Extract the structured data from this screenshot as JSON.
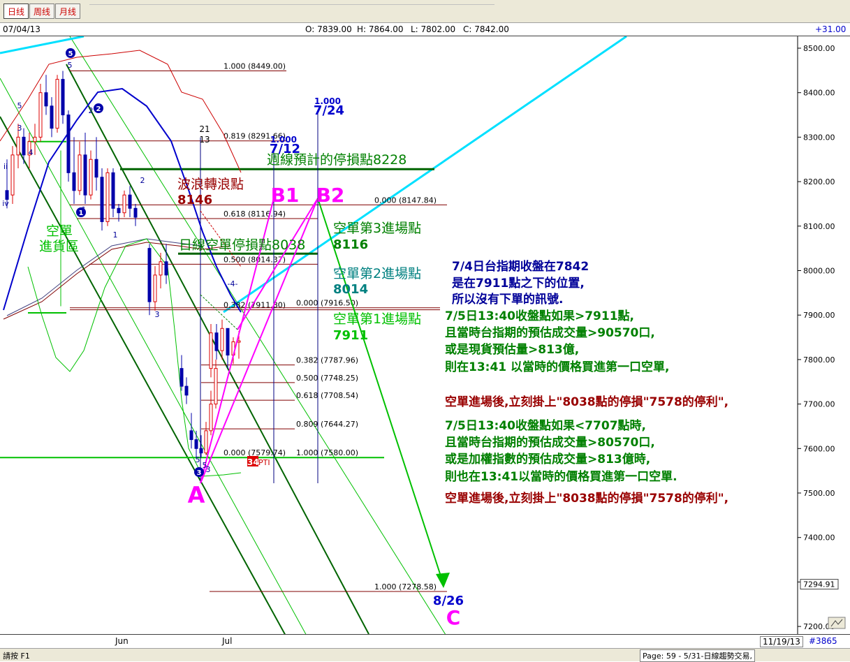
{
  "toolbar": {
    "tabs": [
      {
        "label": "日线",
        "active": true
      },
      {
        "label": "周线",
        "active": false
      },
      {
        "label": "月线",
        "active": false
      }
    ]
  },
  "infobar": {
    "date": "07/04/13",
    "open": "O: 7839.00",
    "high": "H: 7864.00",
    "low": "L: 7802.00",
    "close": "C: 7842.00",
    "change": "+31.00"
  },
  "bottombar": {
    "x_labels": [
      "Jun",
      "Jul"
    ],
    "date": "11/19/13",
    "code": "#3865"
  },
  "statusbar": {
    "left": "請按 F1",
    "right": "Page: 59 - 5/31-日線趨勢交易,"
  },
  "chart_data": {
    "type": "candlestick",
    "ylim": [
      7185,
      8530
    ],
    "y_ticks": [
      "8500.00",
      "8400.00",
      "8300.00",
      "8200.00",
      "8100.00",
      "8000.00",
      "7900.00",
      "7800.00",
      "7700.00",
      "7600.00",
      "7500.00",
      "7400.00",
      "7300.00",
      "7200.00"
    ],
    "last_price_label": "7294.91",
    "colors": {
      "up": "#dd0000",
      "down": "#0000aa",
      "fib": "#800000",
      "green_text": "#008000",
      "note_blue": "#000099",
      "note_green": "#008000",
      "note_red": "#990000",
      "magenta": "#ff00ff",
      "cyan": "#00e0ff"
    },
    "candles": [
      [
        8180,
        8250,
        8140,
        8160
      ],
      [
        8170,
        8280,
        8150,
        8260
      ],
      [
        8260,
        8330,
        8230,
        8300
      ],
      [
        8300,
        8320,
        8240,
        8260
      ],
      [
        8260,
        8310,
        8230,
        8290
      ],
      [
        8290,
        8330,
        8260,
        8300
      ],
      [
        8300,
        8420,
        8290,
        8400
      ],
      [
        8400,
        8440,
        8350,
        8370
      ],
      [
        8370,
        8390,
        8300,
        8320
      ],
      [
        8320,
        8440,
        8310,
        8430
      ],
      [
        8430,
        8449,
        8330,
        8350
      ],
      [
        8350,
        8360,
        8200,
        8220
      ],
      [
        8220,
        8300,
        8150,
        8180
      ],
      [
        8180,
        8290,
        8170,
        8260
      ],
      [
        8260,
        8310,
        8150,
        8170
      ],
      [
        8170,
        8270,
        8160,
        8250
      ],
      [
        8250,
        8300,
        8180,
        8210
      ],
      [
        8210,
        8230,
        8090,
        8110
      ],
      [
        8110,
        8230,
        8100,
        8220
      ],
      [
        8220,
        8230,
        8120,
        8140
      ],
      [
        8140,
        8150,
        8110,
        8130
      ],
      [
        8130,
        8180,
        8120,
        8170
      ],
      [
        8170,
        8190,
        8120,
        8140
      ],
      [
        8140,
        8150,
        8100,
        8120
      ],
      [
        8050,
        8060,
        7900,
        7930
      ],
      [
        7930,
        8010,
        7910,
        7990
      ],
      [
        7990,
        8040,
        7960,
        8020
      ],
      [
        8020,
        8060,
        7970,
        7990
      ],
      [
        7780,
        7810,
        7730,
        7740
      ],
      [
        7740,
        7760,
        7700,
        7720
      ],
      [
        7640,
        7680,
        7600,
        7620
      ],
      [
        7620,
        7640,
        7580,
        7600
      ],
      [
        7600,
        7630,
        7580,
        7590
      ],
      [
        7590,
        7660,
        7585,
        7640
      ],
      [
        7640,
        7730,
        7630,
        7700
      ],
      [
        7700,
        7800,
        7690,
        7780
      ],
      [
        7780,
        7880,
        7760,
        7860
      ],
      [
        7860,
        7880,
        7800,
        7820
      ],
      [
        7820,
        7890,
        7800,
        7870
      ],
      [
        7870,
        7870,
        7780,
        7810
      ],
      [
        7810,
        7850,
        7790,
        7840
      ],
      [
        7839,
        7864,
        7802,
        7842
      ]
    ],
    "fib_levels": [
      {
        "label": "1.000 (8449.00)",
        "y": 8449
      },
      {
        "label": "0.819 (8291.66)",
        "y": 8291.66
      },
      {
        "label": "0.000 (8147.84)",
        "y": 8147.84
      },
      {
        "label": "0.618 (8116.94)",
        "y": 8116.94
      },
      {
        "label": "0.500 (8014.37)",
        "y": 8014.37
      },
      {
        "label": "0.382 (7911.80)",
        "y": 7911.8
      },
      {
        "label": "0.000 (7916.50)",
        "y": 7916.5
      },
      {
        "label": "0.382 (7787.96)",
        "y": 7787.96
      },
      {
        "label": "0.500 (7748.25)",
        "y": 7748.25
      },
      {
        "label": "0.618 (7708.54)",
        "y": 7708.54
      },
      {
        "label": "0.809 (7644.27)",
        "y": 7644.27
      },
      {
        "label": "0.000 (7579.74)",
        "y": 7579.74
      },
      {
        "label": "1.000 (7580.00)",
        "y": 7580
      },
      {
        "label": "1.000 (7278.58)",
        "y": 7278.58
      }
    ],
    "time_markers": [
      {
        "label1": "21",
        "label2": "13"
      },
      {
        "label1": "1.000",
        "label2": "7/12"
      },
      {
        "label1": "1.000",
        "label2": "7/24"
      }
    ],
    "wave_labels": [
      "5",
      "5",
      "3",
      "iv",
      "ii",
      "4",
      "2",
      "1",
      "1",
      "2",
      "3",
      "-4-",
      "5",
      "5",
      "3",
      "iii"
    ],
    "wave_circles": [
      "5",
      "2",
      "1",
      "3"
    ],
    "point_labels": [
      "A",
      "B1",
      "B2",
      "C",
      "8/26"
    ],
    "annotations": [
      {
        "text": "週線預計的停損點8228"
      },
      {
        "text": "波浪轉浪點"
      },
      {
        "text": "8146"
      },
      {
        "text": "空單"
      },
      {
        "text": "進貨區"
      },
      {
        "text": "日線空單停損點8038"
      },
      {
        "text": "空單第3進場點"
      },
      {
        "text": "8116"
      },
      {
        "text": "空單第2進場點"
      },
      {
        "text": "8014"
      },
      {
        "text": "空單第1進場點"
      },
      {
        "text": "7911"
      },
      {
        "text": "34"
      },
      {
        "text": "PTI"
      }
    ],
    "notes": [
      {
        "text": "7/4日台指期收盤在7842",
        "color": "note_blue"
      },
      {
        "text": "是在7911點之下的位置,",
        "color": "note_blue"
      },
      {
        "text": "所以沒有下單的訊號.",
        "color": "note_blue"
      },
      {
        "text": "7/5日13:40收盤點如果>7911點,",
        "color": "note_green"
      },
      {
        "text": "且當時台指期的預估成交量>90570口,",
        "color": "note_green"
      },
      {
        "text": "或是現貨預估量>813億,",
        "color": "note_green"
      },
      {
        "text": "則在13:41 以當時的價格買進第一口空單,",
        "color": "note_green"
      },
      {
        "text": "空單進場後,立刻掛上\"8038點的停損\"7578的停利\",",
        "color": "note_red"
      },
      {
        "text": "7/5日13:40收盤點如果<7707點時,",
        "color": "note_green"
      },
      {
        "text": "且當時台指期的預估成交量>80570口,",
        "color": "note_green"
      },
      {
        "text": "或是加權指數的預估成交量>813億時,",
        "color": "note_green"
      },
      {
        "text": "則也在13:41以當時的價格買進第一口空單.",
        "color": "note_green"
      },
      {
        "text": "空單進場後,立刻掛上\"8038點的停損\"7578的停利\",",
        "color": "note_red"
      }
    ]
  }
}
